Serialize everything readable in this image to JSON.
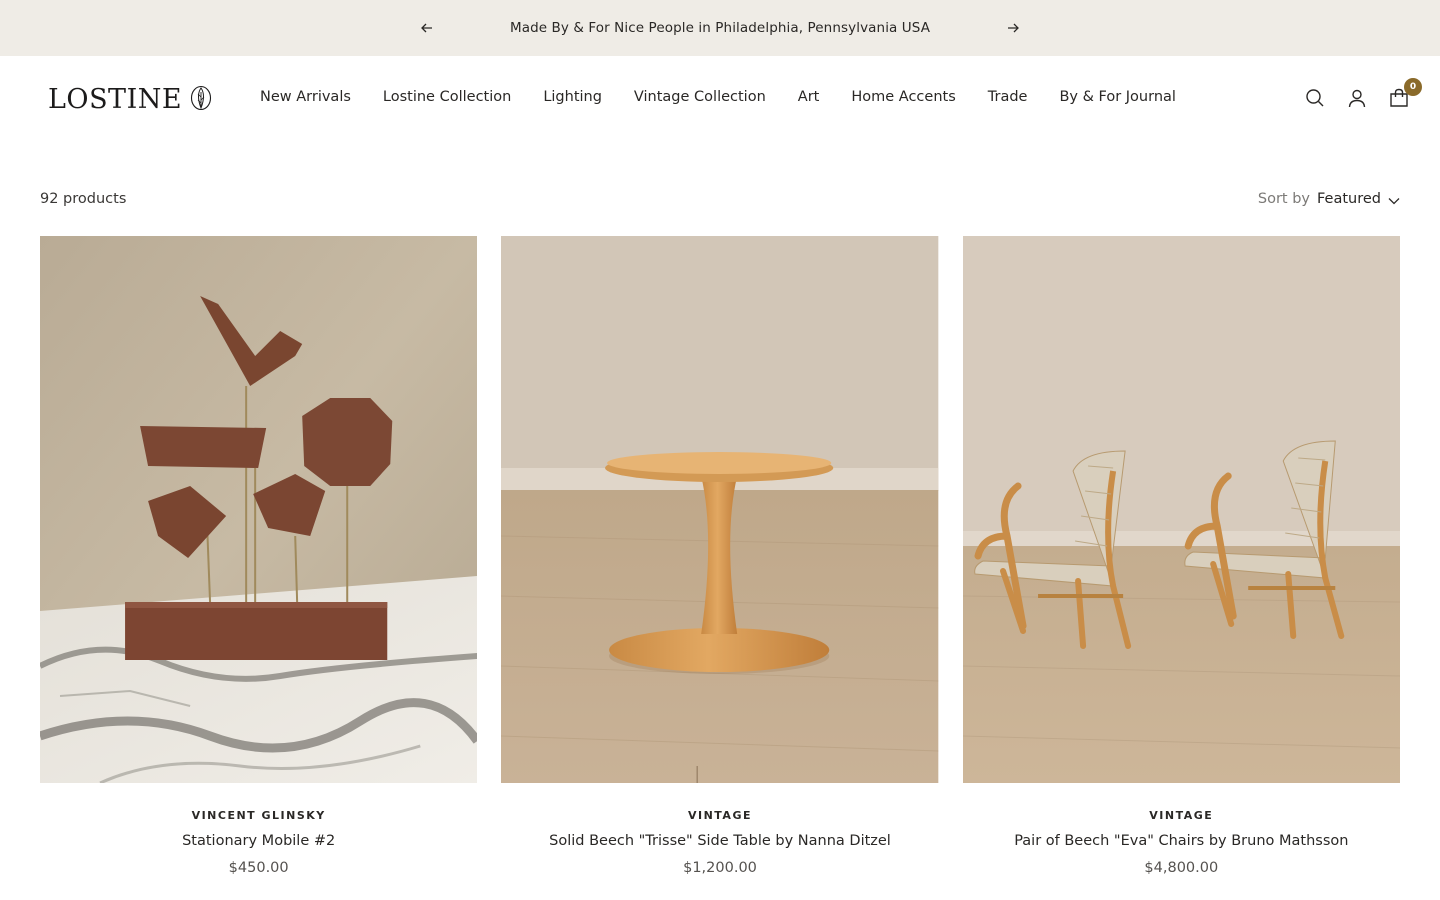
{
  "announcement": {
    "message": "Made By & For Nice People in Philadelphia, Pennsylvania USA",
    "prev_icon": "arrow-left",
    "next_icon": "arrow-right"
  },
  "header": {
    "logo_text": "LOSTINE",
    "nav": [
      {
        "label": "New Arrivals"
      },
      {
        "label": "Lostine Collection"
      },
      {
        "label": "Lighting"
      },
      {
        "label": "Vintage Collection"
      },
      {
        "label": "Art"
      },
      {
        "label": "Home Accents"
      },
      {
        "label": "Trade"
      },
      {
        "label": "By & For Journal"
      }
    ],
    "icons": [
      "search-icon",
      "account-icon",
      "cart-icon"
    ],
    "cart_count": "0"
  },
  "toolbar": {
    "product_count": "92 products",
    "sort_label": "Sort by",
    "sort_value": "Featured"
  },
  "products": [
    {
      "vendor": "VINCENT GLINSKY",
      "title": "Stationary Mobile #2",
      "price": "$450.00"
    },
    {
      "vendor": "VINTAGE",
      "title": "Solid Beech \"Trisse\" Side Table by Nanna Ditzel",
      "price": "$1,200.00"
    },
    {
      "vendor": "VINTAGE",
      "title": "Pair of Beech \"Eva\" Chairs by Bruno Mathsson",
      "price": "$4,800.00"
    }
  ],
  "colors": {
    "announcement_bg": "#efece6",
    "cart_badge": "#8a6a2a",
    "text": "#1c1b1b"
  }
}
